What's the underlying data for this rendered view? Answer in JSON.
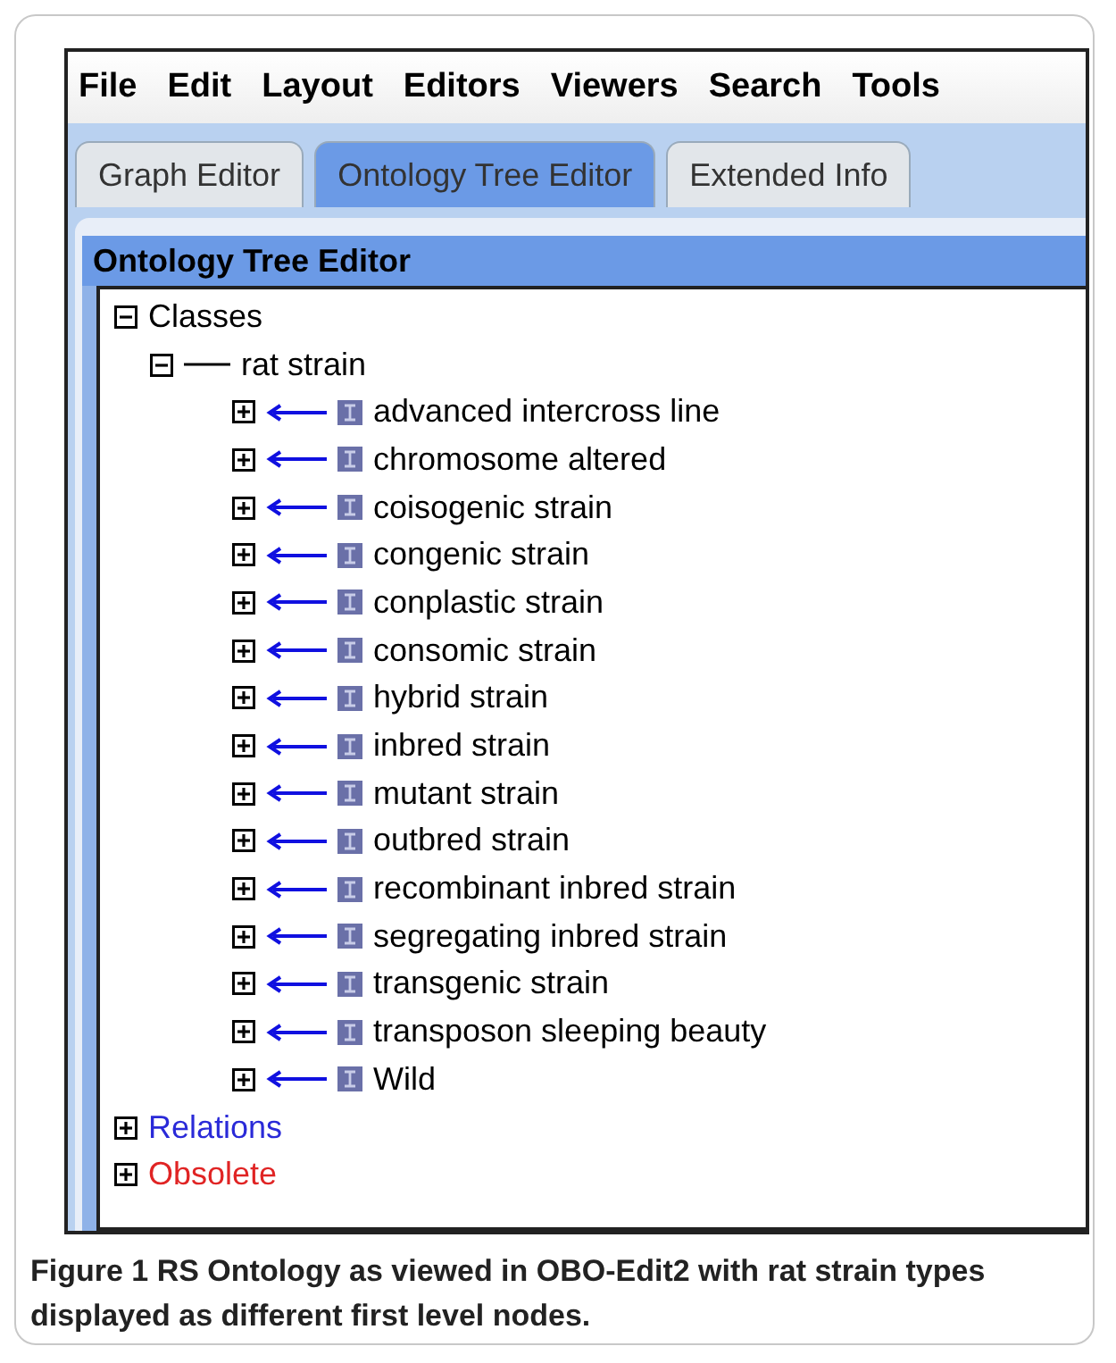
{
  "menu": [
    "File",
    "Edit",
    "Layout",
    "Editors",
    "Viewers",
    "Search",
    "Tools"
  ],
  "tabs": [
    {
      "label": "Graph Editor",
      "selected": false
    },
    {
      "label": "Ontology Tree Editor",
      "selected": true
    },
    {
      "label": "Extended Info",
      "selected": false
    }
  ],
  "panel": {
    "title": "Ontology Tree Editor"
  },
  "tree": [
    {
      "label": "Classes",
      "expanded": true,
      "color": "#000000",
      "children": [
        {
          "label": "rat strain",
          "expanded": true,
          "children": [
            {
              "label": "advanced intercross line",
              "expanded": false
            },
            {
              "label": "chromosome altered",
              "expanded": false
            },
            {
              "label": "coisogenic strain",
              "expanded": false
            },
            {
              "label": "congenic strain",
              "expanded": false
            },
            {
              "label": "conplastic strain",
              "expanded": false
            },
            {
              "label": "consomic strain",
              "expanded": false
            },
            {
              "label": "hybrid strain",
              "expanded": false
            },
            {
              "label": "inbred strain",
              "expanded": false
            },
            {
              "label": "mutant strain",
              "expanded": false
            },
            {
              "label": "outbred strain",
              "expanded": false
            },
            {
              "label": "recombinant inbred strain",
              "expanded": false
            },
            {
              "label": "segregating inbred strain",
              "expanded": false
            },
            {
              "label": "transgenic strain",
              "expanded": false
            },
            {
              "label": "transposon sleeping beauty",
              "expanded": false
            },
            {
              "label": "Wild",
              "expanded": false
            }
          ]
        }
      ]
    },
    {
      "label": "Relations",
      "expanded": false,
      "color": "#2a2ad8"
    },
    {
      "label": "Obsolete",
      "expanded": false,
      "color": "#e02424"
    }
  ],
  "caption": "Figure 1 RS Ontology as viewed in OBO-Edit2 with rat strain types displayed as different first level nodes."
}
